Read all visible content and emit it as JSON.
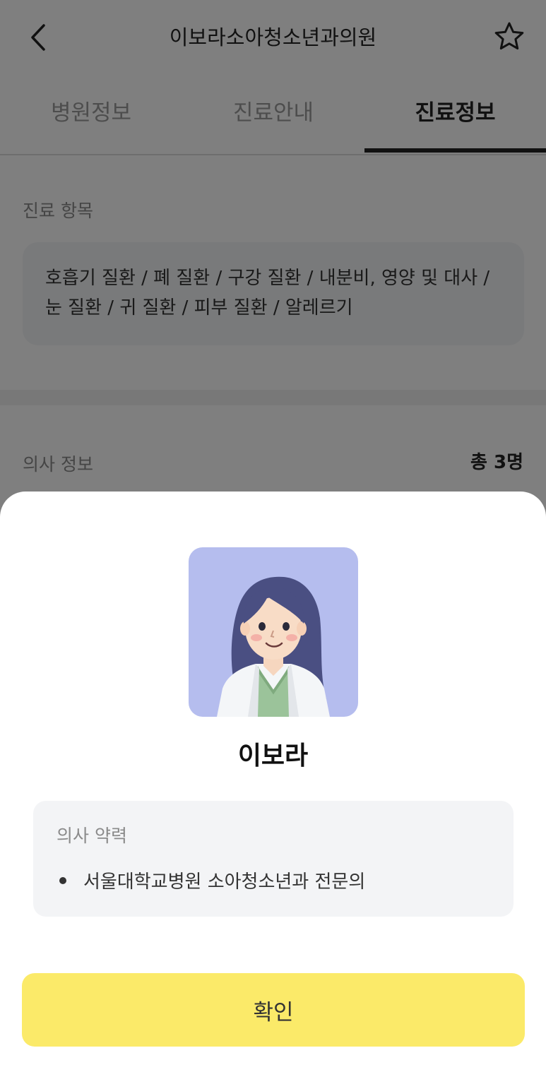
{
  "header": {
    "title": "이보라소아청소년과의원",
    "back_icon": "chevron-left-icon",
    "favorite_icon": "star-outline-icon"
  },
  "tabs": [
    {
      "label": "병원정보",
      "active": false
    },
    {
      "label": "진료안내",
      "active": false
    },
    {
      "label": "진료정보",
      "active": true
    }
  ],
  "treatment": {
    "label": "진료 항목",
    "items_line1": "호흡기 질환 / 폐 질환 / 구강 질환 / 내분비, 영양 및 대사 /",
    "items_line2": "눈 질환 / 귀 질환 / 피부 질환 / 알레르기"
  },
  "doctors": {
    "label": "의사 정보",
    "count": "총 3명"
  },
  "sheet": {
    "doctor_name": "이보라",
    "avatar": "doctor-avatar-illustration",
    "career_title": "의사 약력",
    "career_items": [
      "서울대학교병원 소아청소년과 전문의"
    ],
    "confirm_label": "확인"
  },
  "colors": {
    "accent_yellow": "#fbea69",
    "avatar_bg": "#b5bdee",
    "overlay": "rgba(0,0,0,0.5)"
  }
}
